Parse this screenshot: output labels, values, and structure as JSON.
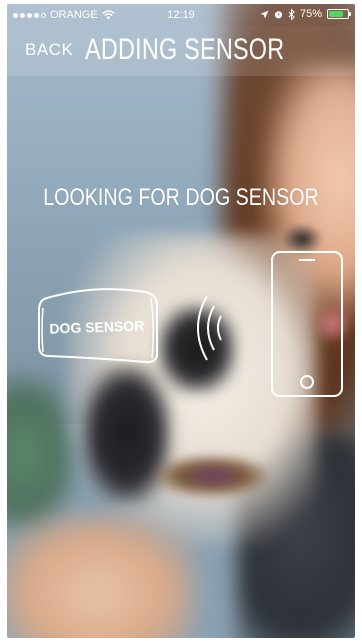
{
  "status_bar": {
    "carrier": "ORANGE",
    "time": "12:19",
    "battery_percent": "75%",
    "battery_level": 0.75,
    "battery_color": "#4cd964",
    "signal_bars": 4,
    "icons": [
      "wifi-icon",
      "location-icon",
      "alarm-icon",
      "bluetooth-icon"
    ]
  },
  "navbar": {
    "back_label": "BACK",
    "title": "ADDING SENSOR"
  },
  "main": {
    "status_text": "LOOKING FOR DOG SENSOR",
    "sensor_label": "DOG SENSOR",
    "icons": [
      "dog-sensor-icon",
      "signal-waves-icon",
      "phone-icon"
    ]
  },
  "colors": {
    "text": "#ffffff",
    "bar_overlay": "rgba(255,255,255,0.12)"
  }
}
